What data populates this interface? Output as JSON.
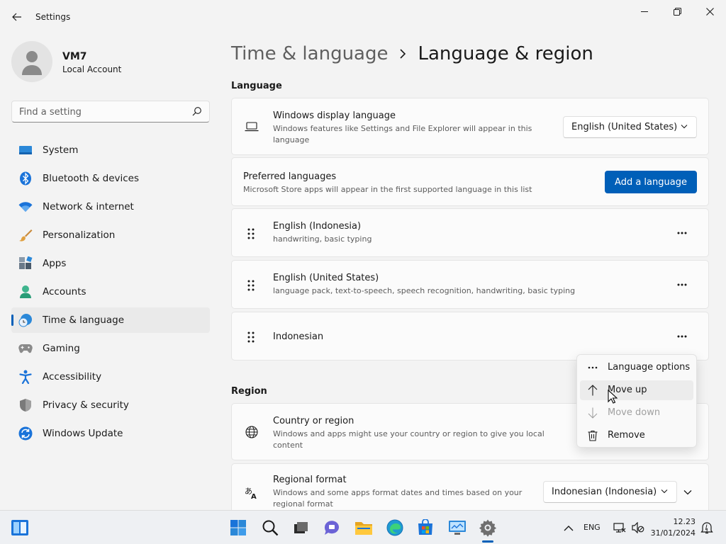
{
  "window": {
    "title": "Settings"
  },
  "user": {
    "name": "VM7",
    "account_type": "Local Account"
  },
  "search": {
    "placeholder": "Find a setting"
  },
  "nav": [
    {
      "label": "System",
      "icon": "system-icon"
    },
    {
      "label": "Bluetooth & devices",
      "icon": "bluetooth-icon"
    },
    {
      "label": "Network & internet",
      "icon": "wifi-icon"
    },
    {
      "label": "Personalization",
      "icon": "brush-icon"
    },
    {
      "label": "Apps",
      "icon": "apps-icon"
    },
    {
      "label": "Accounts",
      "icon": "accounts-icon"
    },
    {
      "label": "Time & language",
      "icon": "time-language-icon",
      "active": true
    },
    {
      "label": "Gaming",
      "icon": "gamepad-icon"
    },
    {
      "label": "Accessibility",
      "icon": "accessibility-icon"
    },
    {
      "label": "Privacy & security",
      "icon": "shield-icon"
    },
    {
      "label": "Windows Update",
      "icon": "update-icon"
    }
  ],
  "breadcrumb": {
    "parent": "Time & language",
    "current": "Language & region"
  },
  "language": {
    "heading": "Language",
    "display": {
      "title": "Windows display language",
      "desc": "Windows features like Settings and File Explorer will appear in this language",
      "value": "English (United States)"
    },
    "preferred": {
      "title": "Preferred languages",
      "desc": "Microsoft Store apps will appear in the first supported language in this list",
      "button": "Add a language"
    },
    "items": [
      {
        "name": "English (Indonesia)",
        "features": "handwriting, basic typing"
      },
      {
        "name": "English (United States)",
        "features": "language pack, text-to-speech, speech recognition, handwriting, basic typing"
      },
      {
        "name": "Indonesian",
        "features": ""
      }
    ]
  },
  "context_menu": {
    "items": [
      {
        "label": "Language options",
        "icon": "more-icon",
        "disabled": false
      },
      {
        "label": "Move up",
        "icon": "arrow-up-icon",
        "disabled": false,
        "hover": true
      },
      {
        "label": "Move down",
        "icon": "arrow-down-icon",
        "disabled": true
      },
      {
        "label": "Remove",
        "icon": "trash-icon",
        "disabled": false
      }
    ]
  },
  "region": {
    "heading": "Region",
    "country": {
      "title": "Country or region",
      "desc": "Windows and apps might use your country or region to give you local content"
    },
    "format": {
      "title": "Regional format",
      "desc": "Windows and some apps format dates and times based on your regional format",
      "value": "Indonesian (Indonesia)"
    }
  },
  "taskbar": {
    "language": "ENG",
    "time": "12.23",
    "date": "31/01/2024"
  },
  "colors": {
    "accent": "#005fb8",
    "background": "#f3f3f3",
    "card": "#fbfbfb"
  }
}
